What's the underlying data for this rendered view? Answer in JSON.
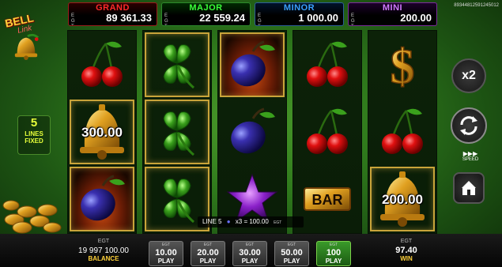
{
  "jackpots": {
    "grand": {
      "name": "GRAND",
      "egt": "EGT",
      "value": "89 361.33"
    },
    "major": {
      "name": "MAJOR",
      "egt": "EGT",
      "value": "22 559.24"
    },
    "minor": {
      "name": "MINOR",
      "egt": "EGT",
      "value": "1 000.00"
    },
    "mini": {
      "name": "MINI",
      "egt": "EGT",
      "value": "200.00"
    }
  },
  "game_id": "89344812591245012",
  "logo": {
    "title": "BELL",
    "subtitle": "Link"
  },
  "lines_fixed": {
    "number": "5",
    "label1": "LINES",
    "label2": "FIXED"
  },
  "reels": [
    [
      "cherries",
      "bell",
      "plum"
    ],
    [
      "clover",
      "clover",
      "clover"
    ],
    [
      "plum",
      "plum",
      "star"
    ],
    [
      "cherries",
      "cherries",
      "bar"
    ],
    [
      "dollar",
      "cherries",
      "bell"
    ]
  ],
  "bell_values": {
    "reel1": "300.00",
    "reel5": "200.00"
  },
  "bar_label": "BAR",
  "line_info": {
    "line": "LINE 5",
    "multiplier": "x3 = 100.00",
    "egt": "EGT"
  },
  "controls": {
    "multiplier": "x2",
    "speed_label": "SPEED"
  },
  "balance": {
    "egt": "EGT",
    "value": "19 997 100.00",
    "label": "BALANCE"
  },
  "bets": [
    {
      "egt": "EGT",
      "value": "10.00",
      "play": "PLAY",
      "active": false
    },
    {
      "egt": "EGT",
      "value": "20.00",
      "play": "PLAY",
      "active": false
    },
    {
      "egt": "EGT",
      "value": "30.00",
      "play": "PLAY",
      "active": false
    },
    {
      "egt": "EGT",
      "value": "50.00",
      "play": "PLAY",
      "active": false
    },
    {
      "egt": "EGT",
      "value": "100",
      "play": "PLAY",
      "active": true
    }
  ],
  "win": {
    "egt": "EGT",
    "value": "97.40",
    "label": "WIN"
  },
  "colors": {
    "grand": "#ff2a2a",
    "major": "#39ff39",
    "minor": "#3aa0ff",
    "mini": "#d07aff",
    "accent": "#ffd23a"
  }
}
